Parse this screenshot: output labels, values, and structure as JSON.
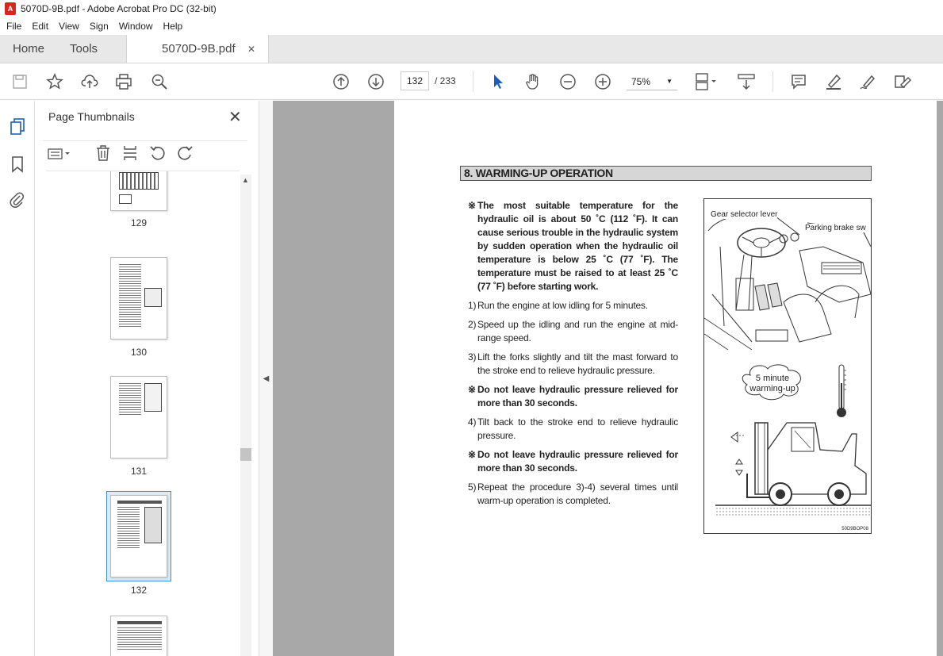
{
  "window": {
    "title": "5070D-9B.pdf - Adobe Acrobat Pro DC (32-bit)",
    "app_icon": "pdf-icon"
  },
  "menu": [
    "File",
    "Edit",
    "View",
    "Sign",
    "Window",
    "Help"
  ],
  "tabs": {
    "home": "Home",
    "tools": "Tools",
    "document": "5070D-9B.pdf",
    "close_glyph": "✕"
  },
  "toolbar": {
    "page_current": "132",
    "page_total": "/  233",
    "zoom": "75%"
  },
  "thumbnails": {
    "title": "Page Thumbnails",
    "pages": [
      "129",
      "130",
      "131",
      "132"
    ],
    "selected": "132"
  },
  "document": {
    "heading": "8. WARMING-UP OPERATION",
    "paragraphs": [
      {
        "mark": "※",
        "bold": true,
        "text": "The most suitable temperature for the hydraulic oil is about 50 ˚C (112 ˚F). It can cause serious trouble in the hydraulic system by sudden operation when the hydraulic oil temperature is below 25 ˚C (77 ˚F). The temperature must be raised to at least 25 ˚C (77 ˚F) before starting work."
      },
      {
        "mark": "1)",
        "bold": false,
        "text": "Run the engine at low idling for 5 minutes."
      },
      {
        "mark": "2)",
        "bold": false,
        "text": "Speed up the idling and run the engine at mid-range speed."
      },
      {
        "mark": "3)",
        "bold": false,
        "text": "Lift the forks slightly and tilt the mast forward to the stroke end to relieve  hydraulic pressure."
      },
      {
        "mark": "※",
        "bold": true,
        "text": "Do not leave hydraulic pressure relieved for more than 30 seconds."
      },
      {
        "mark": "4)",
        "bold": false,
        "text": "Tilt back to the stroke end to relieve hydraulic pressure."
      },
      {
        "mark": "※",
        "bold": true,
        "text": "Do not leave hydraulic pressure relieved for more than 30 seconds."
      },
      {
        "mark": "5)",
        "bold": false,
        "text": "Repeat the procedure 3)-4) several times until warm-up operation is completed."
      }
    ],
    "figure": {
      "label_gear": "Gear selector lever",
      "label_parking": "Parking brake sw",
      "bubble_line1": "5 minute",
      "bubble_line2": "warming-up",
      "code": "50D9BOP08"
    }
  }
}
